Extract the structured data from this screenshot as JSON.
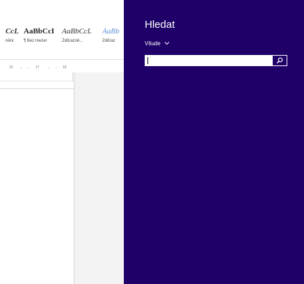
{
  "colors": {
    "charm_background": "#1f0068",
    "charm_text": "#ffffff",
    "search_button": "#1f0068",
    "style_emphasis_blue": "#5b8fd6"
  },
  "word": {
    "styles": [
      {
        "preview": "CcL",
        "name": "nění",
        "preview_style": "bold-italic"
      },
      {
        "preview": "AaBbCcI",
        "name": "¶ Bez mezer",
        "preview_style": "bold"
      },
      {
        "preview": "AaBbCcL",
        "name": "Zdůrazně...",
        "preview_style": "italic"
      },
      {
        "preview": "AaBb",
        "name": "Zdůraz",
        "preview_style": "italic-blue"
      }
    ],
    "ruler_ticks": [
      "16",
      "17",
      "18"
    ]
  },
  "search_charm": {
    "title": "Hledat",
    "scope_label": "Všude",
    "scope_icon": "chevron-down-icon",
    "input_value": "",
    "input_placeholder": "",
    "search_icon": "magnifier-icon"
  }
}
